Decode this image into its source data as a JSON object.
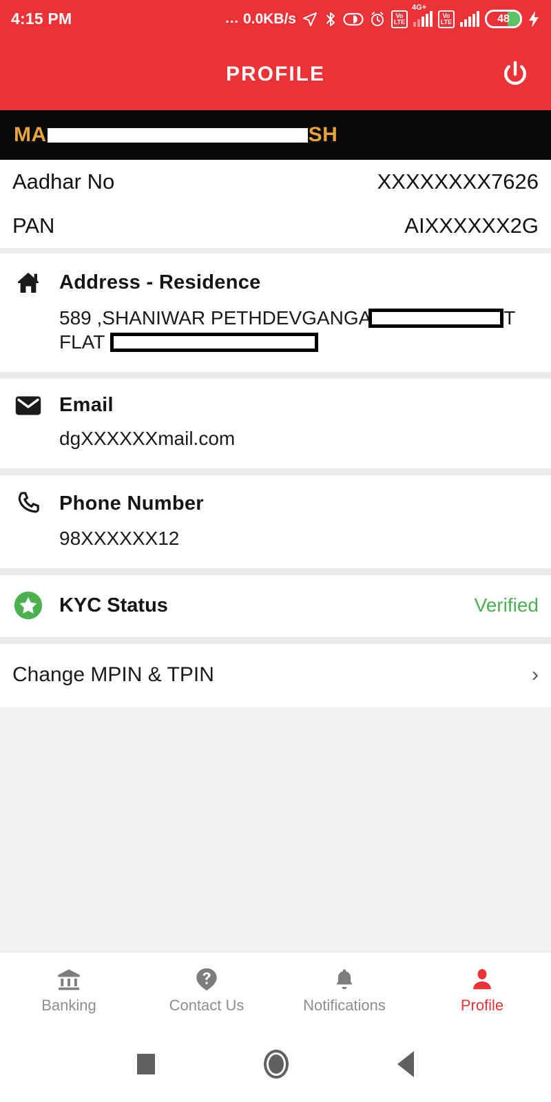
{
  "status_bar": {
    "time": "4:15 PM",
    "dots": "...",
    "network_speed": "0.0KB/s",
    "volte_line1": "Vo",
    "volte_line2": "LTE",
    "network_type": "4G+",
    "battery_level": "48",
    "icons": [
      "location-arrow-icon",
      "bluetooth-icon",
      "dnd-icon",
      "alarm-icon",
      "volte-icon",
      "signal-icon",
      "volte-icon",
      "signal-icon",
      "battery-icon",
      "charging-bolt-icon"
    ]
  },
  "header": {
    "title": "PROFILE",
    "logout_icon": "power-icon",
    "background_color": "#ED3237"
  },
  "name_bar": {
    "prefix": "MA",
    "suffix": "SH",
    "redacted": true,
    "text_color": "#E8A33D",
    "background_color": "#0a0a0a"
  },
  "identity": {
    "rows": [
      {
        "label": "Aadhar No",
        "value": "XXXXXXXX7626"
      },
      {
        "label": "PAN",
        "value": "AIXXXXXX2G"
      }
    ]
  },
  "address": {
    "icon": "home-icon",
    "title": "Address - Residence",
    "line1_text": "589  ,SHANIWAR PETHDEVGANGA",
    "line1_trailing": "T",
    "line2_text": "FLAT"
  },
  "email": {
    "icon": "envelope-icon",
    "title": "Email",
    "value": "dgXXXXXXmail.com"
  },
  "phone": {
    "icon": "phone-icon",
    "title": "Phone Number",
    "value": "98XXXXXX12"
  },
  "kyc": {
    "icon": "star-circle-icon",
    "title": "KYC Status",
    "status": "Verified",
    "status_color": "#4CAF50"
  },
  "mpin": {
    "label": "Change MPIN & TPIN",
    "chevron": "›"
  },
  "bottom_nav": {
    "items": [
      {
        "label": "Banking",
        "icon": "bank-icon",
        "active": false
      },
      {
        "label": "Contact Us",
        "icon": "help-bubble-icon",
        "active": false
      },
      {
        "label": "Notifications",
        "icon": "bell-icon",
        "active": false
      },
      {
        "label": "Profile",
        "icon": "person-icon",
        "active": true
      }
    ],
    "active_color": "#ED3237"
  },
  "android_nav": {
    "recents": "square-icon",
    "home": "circle-icon",
    "back": "triangle-back-icon"
  }
}
